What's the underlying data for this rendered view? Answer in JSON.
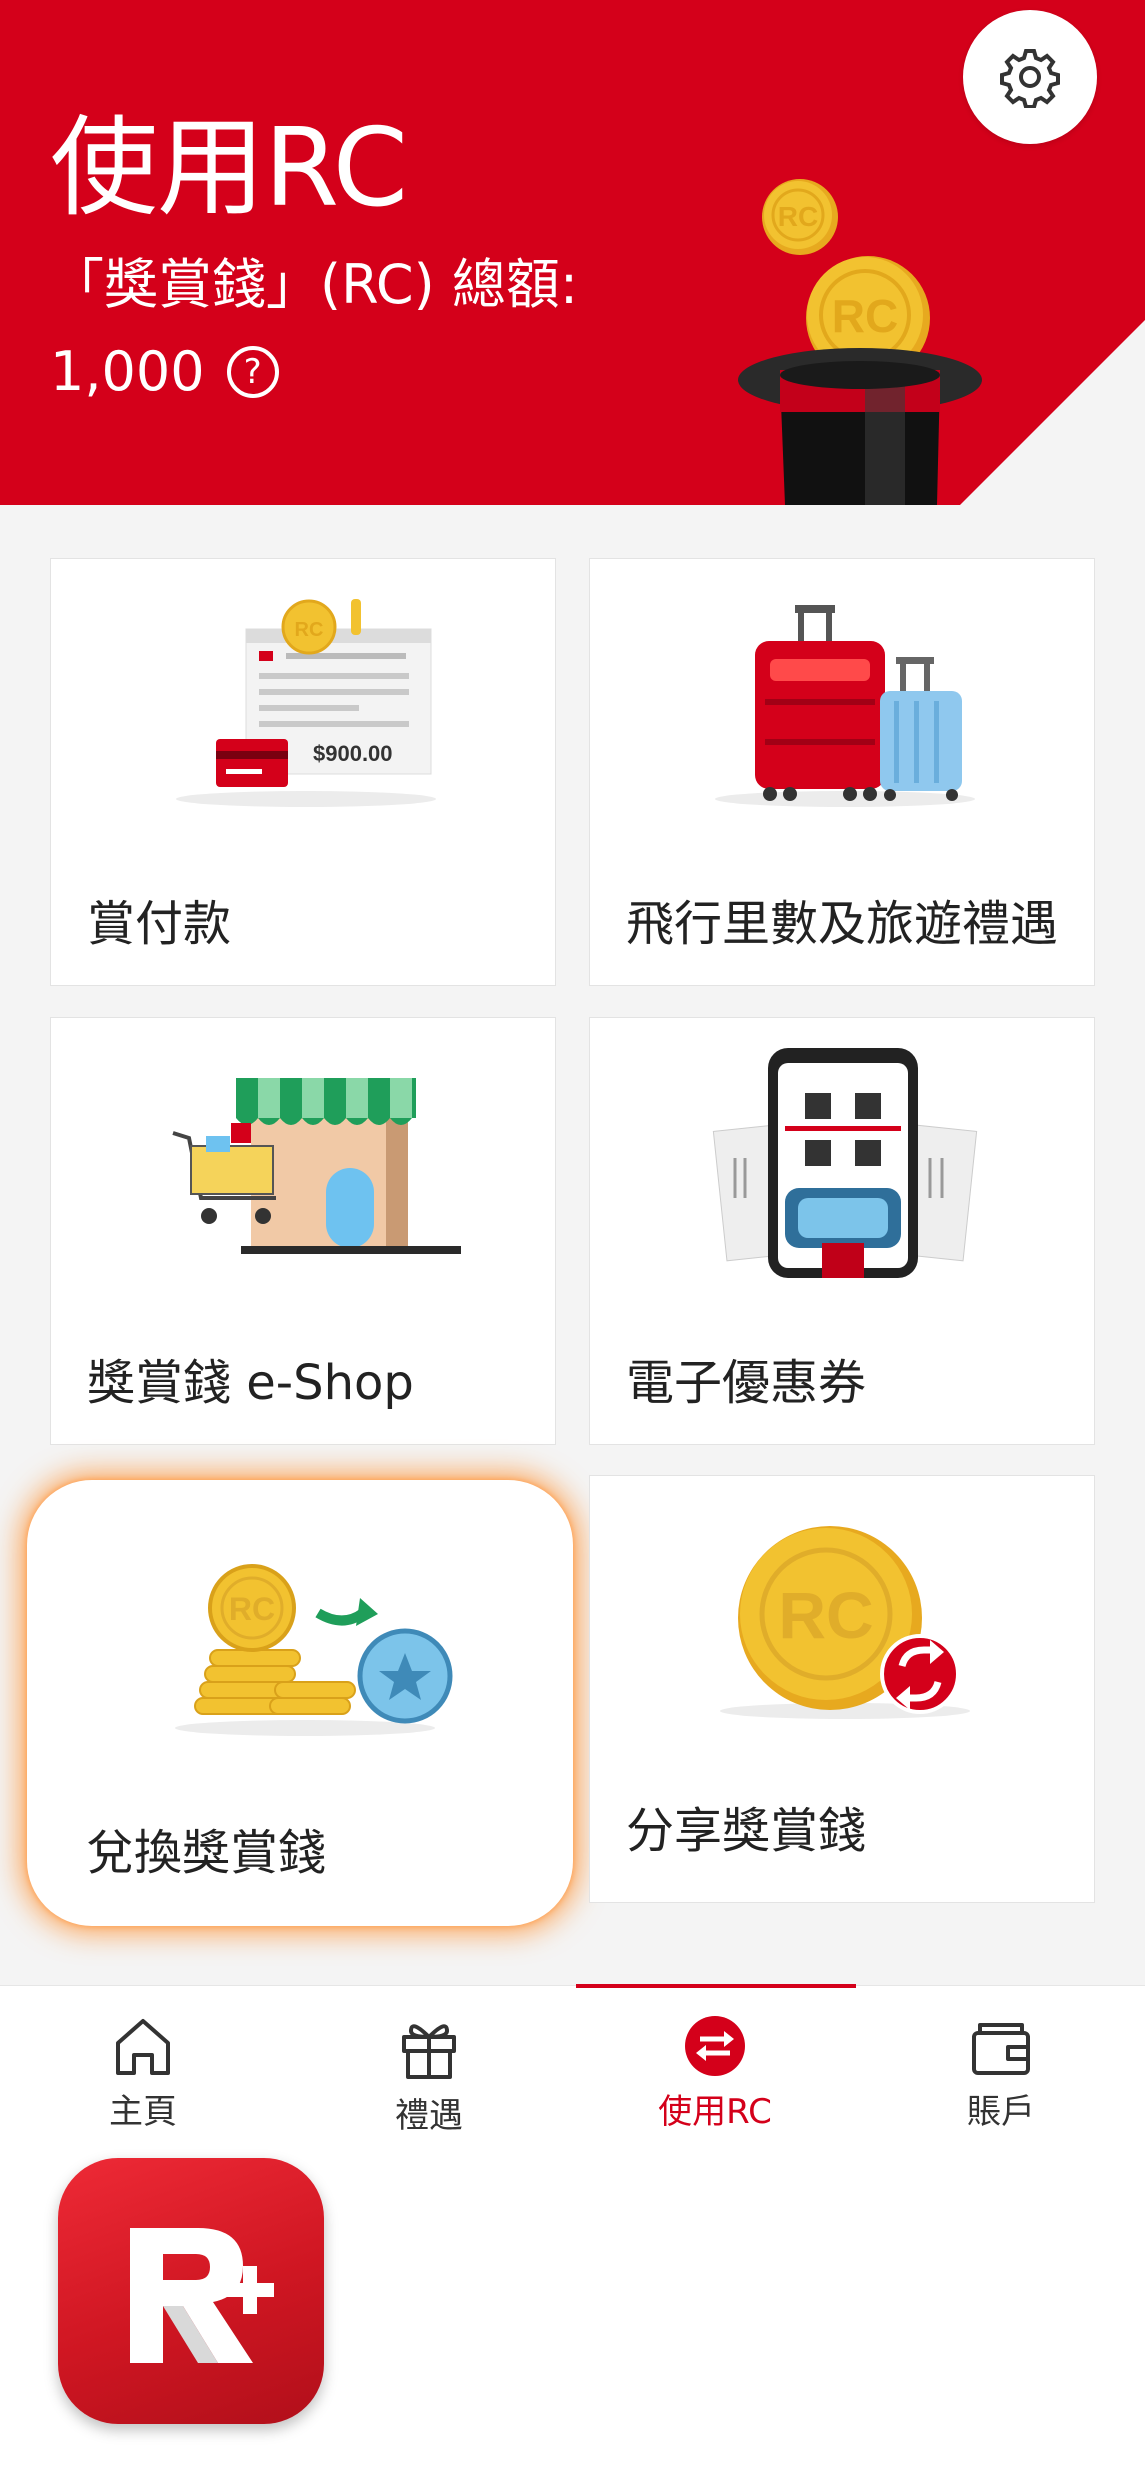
{
  "header": {
    "title": "使用RC",
    "balance_label": "「獎賞錢」(RC) 總額:",
    "balance_value": "1,000",
    "help_icon": "?",
    "settings_icon": "gear-icon",
    "coin_text": "RC"
  },
  "cards": [
    {
      "label": "賞付款",
      "icon": "bill-payment-illustration",
      "amount_text": "$900.00"
    },
    {
      "label": "飛行里數及旅遊禮遇",
      "icon": "luggage-illustration"
    },
    {
      "label": "獎賞錢 e-Shop",
      "icon": "shop-illustration"
    },
    {
      "label": "電子優惠券",
      "icon": "qr-coupon-illustration"
    },
    {
      "label": "兌換獎賞錢",
      "icon": "convert-coins-illustration"
    },
    {
      "label": "分享獎賞錢",
      "icon": "share-coin-illustration"
    }
  ],
  "tabs": [
    {
      "label": "主頁",
      "icon": "home-icon"
    },
    {
      "label": "禮遇",
      "icon": "gift-icon"
    },
    {
      "label": "使用RC",
      "icon": "swap-icon",
      "active": true
    },
    {
      "label": "賬戶",
      "icon": "wallet-icon"
    }
  ],
  "colors": {
    "brand_red": "#d4001a",
    "coin_gold": "#f2c230",
    "highlight_glow": "#ff8c28"
  }
}
